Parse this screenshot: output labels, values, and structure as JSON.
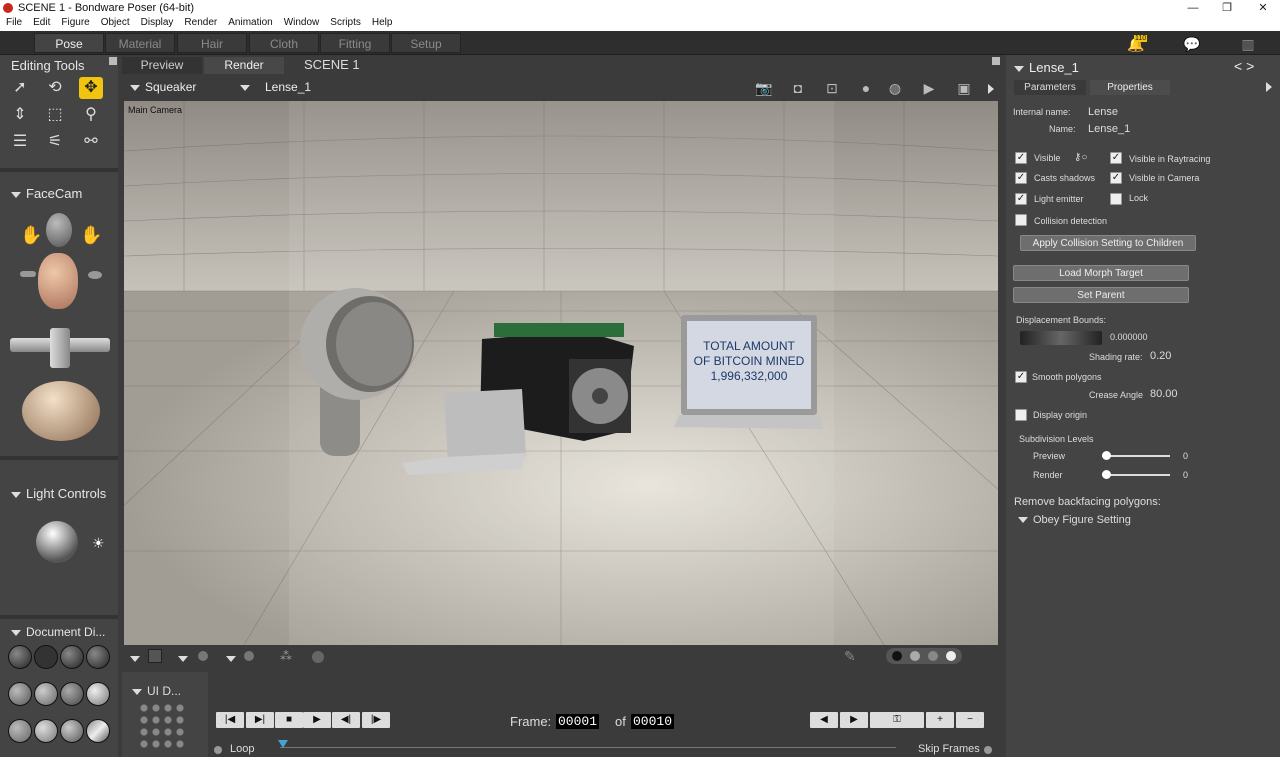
{
  "window": {
    "title": "SCENE 1 - Bondware Poser (64-bit)",
    "min": "—",
    "max": "❐",
    "close": "✕"
  },
  "menu": [
    "File",
    "Edit",
    "Figure",
    "Object",
    "Display",
    "Render",
    "Animation",
    "Window",
    "Scripts",
    "Help"
  ],
  "rooms": [
    "Pose",
    "Material",
    "Hair",
    "Cloth",
    "Fitting",
    "Setup"
  ],
  "active_room": "Pose",
  "notifications": {
    "badge": "110"
  },
  "left": {
    "editing_tools": "Editing Tools",
    "facecam": "FaceCam",
    "light_controls": "Light Controls",
    "document_display": "Document Di..."
  },
  "viewport": {
    "tabs": [
      "Preview",
      "Render"
    ],
    "scene_title": "SCENE 1",
    "figure_select": "Squeaker",
    "actor_select": "Lense_1",
    "camera_label": "Main Camera",
    "screen_text": [
      "TOTAL AMOUNT",
      "OF BITCOIN MINED",
      "1,996,332,000"
    ]
  },
  "ui_dots": "UI D...",
  "timeline": {
    "frame_label": "Frame:",
    "frame_current": "00001",
    "of_label": "of",
    "frame_total": "00010",
    "loop": "Loop",
    "skip": "Skip Frames"
  },
  "props": {
    "title": "Lense_1",
    "tabs": [
      "Parameters",
      "Properties"
    ],
    "internal_name_label": "Internal name:",
    "internal_name": "Lense",
    "name_label": "Name:",
    "name": "Lense_1",
    "checks": {
      "visible": "Visible",
      "visible_raytracing": "Visible in Raytracing",
      "casts_shadows": "Casts shadows",
      "visible_camera": "Visible in Camera",
      "light_emitter": "Light emitter",
      "lock": "Lock",
      "collision": "Collision detection",
      "smooth": "Smooth polygons",
      "display_origin": "Display origin"
    },
    "apply_collision": "Apply Collision Setting to Children",
    "load_morph": "Load Morph Target",
    "set_parent": "Set Parent",
    "displacement_label": "Displacement Bounds:",
    "displacement_value": "0.000000",
    "shading_label": "Shading rate:",
    "shading_value": "0.20",
    "crease_label": "Crease Angle",
    "crease_value": "80.00",
    "subdiv_label": "Subdivision Levels",
    "preview_label": "Preview",
    "preview_value": "0",
    "render_label": "Render",
    "render_value": "0",
    "backface_label": "Remove backfacing polygons:",
    "obey": "Obey Figure Setting"
  }
}
